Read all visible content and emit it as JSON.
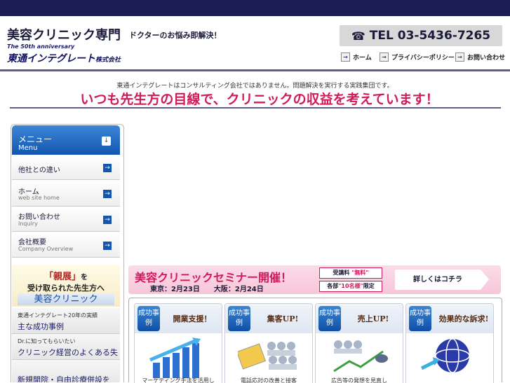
{
  "header": {
    "title": "美容クリニック専門",
    "subtitle": "ドクターのお悩み即解決！",
    "anniversary": "The 50th anniversary",
    "company": "東通インテグレート",
    "company_suffix": "株式会社",
    "tel": "TEL 03-5436-7265",
    "nav": [
      "ホーム",
      "プライバシーポリシー",
      "お問い合わせ"
    ]
  },
  "tagline": {
    "small": "東通インテグレートはコンサルティング会社ではありません。問題解決を実行する実践集団です。",
    "big": "いつも先生方の目線で、クリニックの収益を考えています！"
  },
  "sidebar": {
    "menu_title": "メニュー",
    "menu_sub": "Menu",
    "items": [
      {
        "label": "他社との違い",
        "sub": ""
      },
      {
        "label": "ホーム",
        "sub": "web site home"
      },
      {
        "label": "お問い合わせ",
        "sub": "Inquiry"
      },
      {
        "label": "会社概要",
        "sub": "Company Overview"
      }
    ],
    "banner1": {
      "l1a": "「親展」",
      "l1b": "を",
      "l2": "受け取られた先生方へ",
      "l3": "美容クリニック"
    },
    "banner2": {
      "small": "東通インテグレート20年の実績",
      "big": "主な成功事例"
    },
    "banner3": {
      "small": "Dr.に知ってもらいたい",
      "big": "クリニック経営のよくある失敗"
    },
    "banner4": {
      "big": "新規開院・自由診療併設を"
    }
  },
  "seminar": {
    "heading": "美容クリニックセミナー開催！",
    "dates": "東京：2月23日　　大阪：2月24日",
    "fee_label": "受講料",
    "fee_value": "\"無料\"",
    "cap_label": "各部",
    "cap_value": "\"10名様\"",
    "cap_suffix": "限定",
    "more": "詳しくはコチラ"
  },
  "cases": [
    {
      "badge": "成功事例",
      "title": "開業支援！",
      "caption": "マーケティング手法を活用し"
    },
    {
      "badge": "成功事例",
      "title": "集客UP!",
      "caption": "電話応対の改善と接客"
    },
    {
      "badge": "成功事例",
      "title": "売上UP!",
      "caption": "広告等の発想を見直し"
    },
    {
      "badge": "成功事例",
      "title": "効果的な訴求!",
      "caption": ""
    }
  ],
  "colors": {
    "navy": "#1c1d52",
    "accent_pink": "#d01a5a",
    "menu_blue": "#1356b0"
  }
}
